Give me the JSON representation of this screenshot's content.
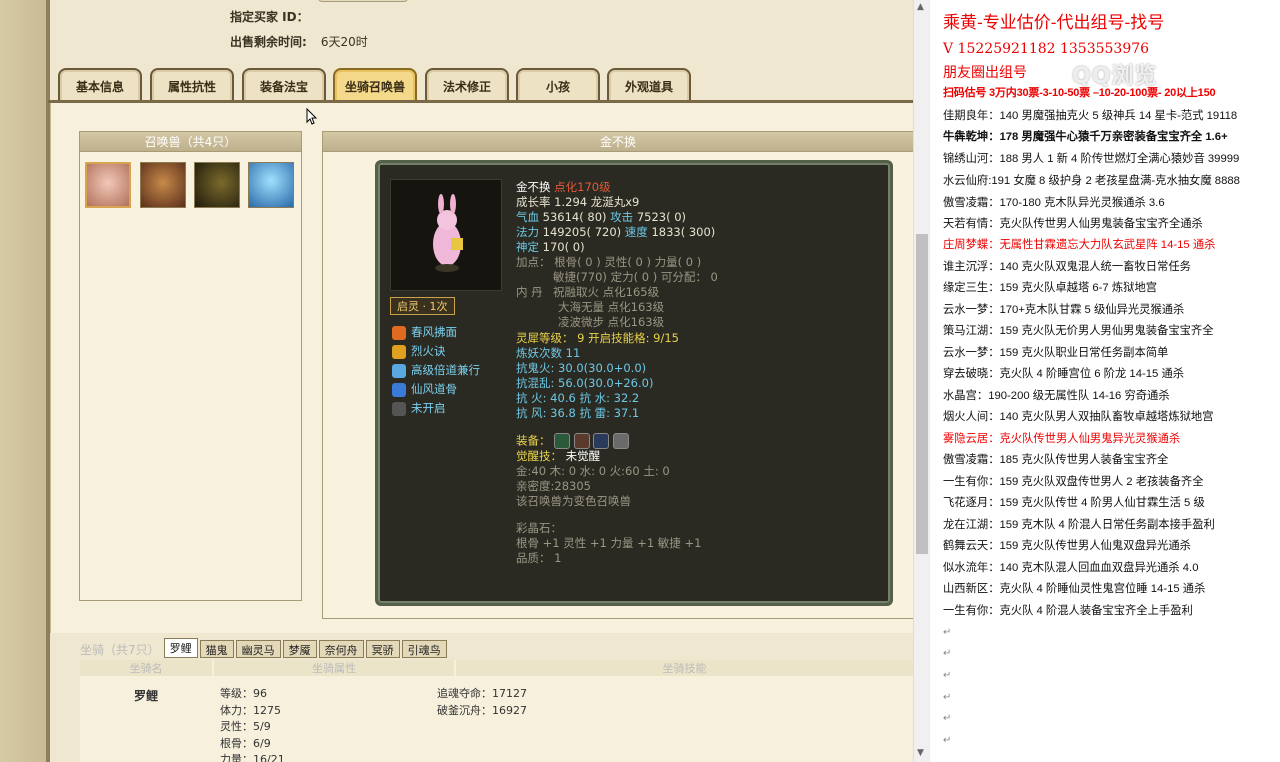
{
  "header": {
    "buyer_id_label": "指定买家 ID：",
    "time_label": "出售剩余时间:",
    "time_value": "6天20时"
  },
  "tabs": [
    "基本信息",
    "属性抗性",
    "装备法宝",
    "坐骑召唤兽",
    "法术修正",
    "小孩",
    "外观道具"
  ],
  "active_tab": "坐骑召唤兽",
  "pets_box": {
    "title": "召唤兽（共4只）"
  },
  "detail_box": {
    "title": "金不换"
  },
  "pet": {
    "name": "金不换",
    "name_tag": "点化170级",
    "growth": "成长率 1.294 龙涎丸x9",
    "qixue_label": "气血",
    "qixue": "53614( 80)",
    "gongji_label": "攻击",
    "gongji": "7523( 0)",
    "fali_label": "法力",
    "fali": "149205( 720)",
    "sudu_label": "速度",
    "sudu": "1833( 300)",
    "shending_label": "神定",
    "shending": "170( 0)",
    "jiadian_1": "加点：  根骨( 0 ) 灵性( 0 ) 力量( 0 )",
    "jiadian_2": "敏捷(770) 定力( 0 ) 可分配：  0",
    "neidan_label": "内    丹",
    "neidan_1": "祝融取火 点化165级",
    "neidan_2": "大海无量 点化163级",
    "neidan_3": "凌波微步 点化163级",
    "lingxi_label": "灵犀等级：",
    "lingxi": "9 开启技能格: 9/15",
    "lianyao": "炼妖次数 11",
    "res": [
      "抗鬼火: 30.0(30.0+0.0)",
      "抗混乱: 56.0(30.0+26.0)",
      "抗   火: 40.6 抗   水: 32.2",
      "抗   风: 36.8 抗   雷: 37.1"
    ],
    "zhuangbei_label": "装备：",
    "juexing_label": "觉醒技：",
    "juexing": "未觉醒",
    "jin": "金:40 木: 0 水: 0 火:60 土: 0",
    "qinmi": "亲密度:28305",
    "bianse": "该召唤兽为变色召唤兽",
    "caijingshi_label": "彩晶石：",
    "caijingshi_1": "根骨 +1 灵性 +1 力量 +1 敏捷 +1",
    "caijingshi_2": "品质：  1",
    "qiling_badge": "启灵 · 1次",
    "skills": [
      "春风拂面",
      "烈火诀",
      "高级倍道兼行",
      "仙风道骨",
      "未开启"
    ]
  },
  "mount_tabs": {
    "label": "坐骑（共7只）",
    "items": [
      "罗鲤",
      "猫鬼",
      "幽灵马",
      "梦魇",
      "奈何舟",
      "冥骄",
      "引魂鸟"
    ]
  },
  "mount_table": {
    "col1": "坐骑名",
    "col2": "坐骑属性",
    "col3": "坐骑技能",
    "name": "罗鲤",
    "attrs": [
      "等级：96",
      "体力：1275",
      "灵性：5/9",
      "根骨：6/9",
      "力量：16/21"
    ],
    "skills": [
      "追魂夺命：17127",
      "破釜沉舟：16927"
    ]
  },
  "right_panel": {
    "title": "乘黄-专业估价-代出组号-找号",
    "phone": "V    15225921182   1353553976",
    "moments": "朋友圈出组号",
    "scan": "扫码估号 3万内30票-3-10-50票 –10-20-100票- 20以上150",
    "lines": [
      "佳期良年：140 男魔强抽克火 5 级神兵 14 星卡-范式 19118",
      "牛犇乾坤：178 男魔强牛心猿千万亲密装备宝宝齐全 1.6+",
      "锦绣山河：188 男人 1 新 4 阶传世燃灯全满心猿妙音 39999",
      "水云仙府:191 女魔 8 级护身 2 老孩星盘满-克水抽女魔 8888",
      "傲雪凌霜：170-180 克木队异光灵猴通杀 3.6",
      "天若有情：克火队传世男人仙男鬼装备宝宝齐全通杀",
      "庄周梦蝶：无属性甘霖遗忘大力队玄武星阵 14-15 通杀",
      "谁主沉浮：140 克火队双鬼混人统一畜牧日常任务",
      "缘定三生：159 克火队卓越塔 6-7 炼狱地宫",
      "云水一梦：170+克木队甘霖 5 级仙异光灵猴通杀",
      "策马江湖：159 克火队无价男人男仙男鬼装备宝宝齐全",
      "云水一梦：159 克火队职业日常任务副本简单",
      "穿去破晓：克火队 4 阶睡宫位 6 阶龙 14-15 通杀",
      "水晶宫：190-200 级无属性队 14-16 穷奇通杀",
      "烟火人间：140 克火队男人双抽队畜牧卓越塔炼狱地宫",
      "雾隐云居：克火队传世男人仙男鬼异光灵猴通杀",
      "傲雪凌霜：185 克火队传世男人装备宝宝齐全",
      "一生有你：159 克火队双盘传世男人 2 老孩装备齐全",
      "飞花逐月：159 克火队传世 4 阶男人仙甘霖生活 5 级",
      "龙在江湖：159 克木队 4 阶混人日常任务副本接手盈利",
      "鹤舞云天：159 克火队传世男人仙鬼双盘异光通杀",
      "似水流年：140 克木队混人回血血双盘异光通杀 4.0",
      "山西新区：克火队 4 阶睡仙灵性鬼宫位睡 14-15 通杀",
      "一生有你：克火队 4 阶混人装备宝宝齐全上手盈利"
    ],
    "return_mark": "↵"
  },
  "watermark": "QQ浏览",
  "colors": {
    "accent_red": "#e00000",
    "pet_green": "#6cc8e6",
    "pet_red": "#e25a3a",
    "pet_yellow": "#e6d24a"
  }
}
